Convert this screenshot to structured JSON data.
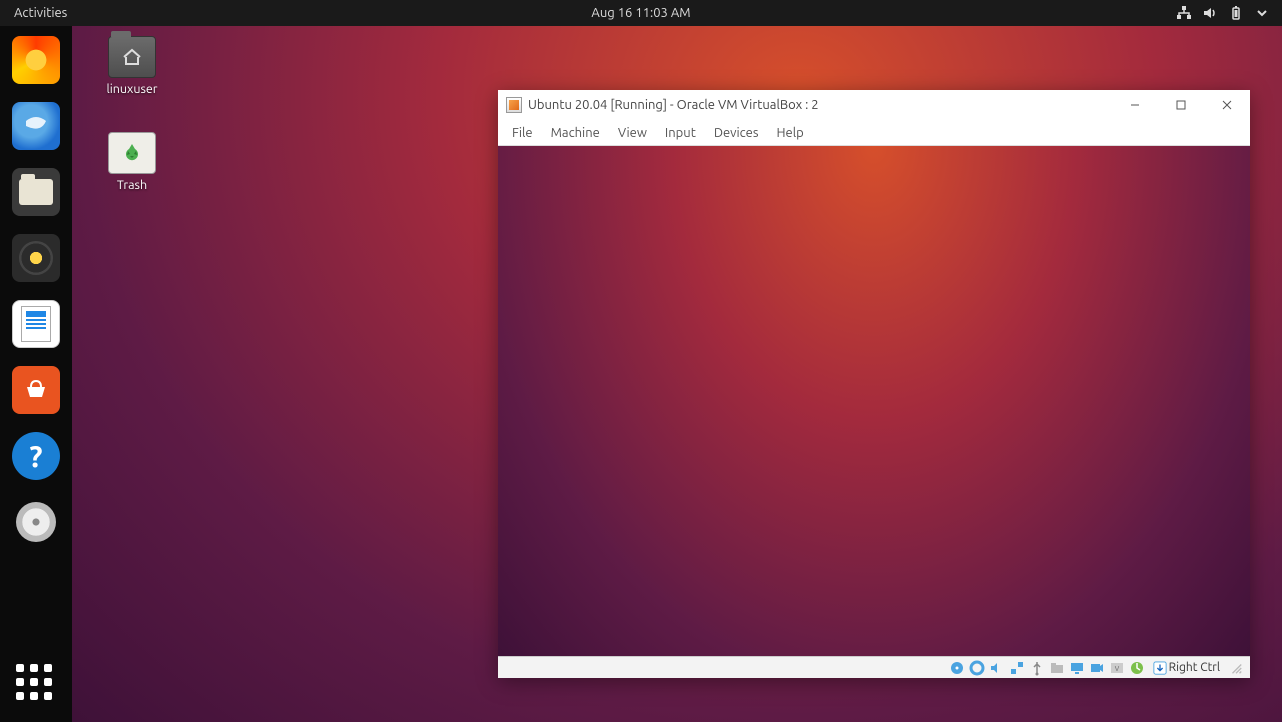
{
  "topbar": {
    "activities_label": "Activities",
    "clock": "Aug 16  11:03 AM"
  },
  "desktop_icons": {
    "home_folder": "linuxuser",
    "trash": "Trash"
  },
  "dock": {
    "items": [
      "firefox",
      "thunderbird",
      "files",
      "rhythmbox",
      "libreoffice-writer",
      "software",
      "help",
      "disc"
    ]
  },
  "vbox": {
    "title": "Ubuntu 20.04 [Running] - Oracle VM VirtualBox : 2",
    "menu": {
      "file": "File",
      "machine": "Machine",
      "view": "View",
      "input": "Input",
      "devices": "Devices",
      "help": "Help"
    },
    "hostkey": "Right Ctrl",
    "status_icons": [
      "harddisk-icon",
      "optical-icon",
      "audio-icon",
      "network-icon",
      "usb-icon",
      "shared-folder-icon",
      "display-icon",
      "recording-icon",
      "vrde-icon",
      "cpu-icon",
      "hostkey-icon"
    ]
  },
  "colors": {
    "ubuntu_orange": "#e95420",
    "thunderbird_blue": "#1f6fd0",
    "help_blue": "#1a7fd4"
  }
}
